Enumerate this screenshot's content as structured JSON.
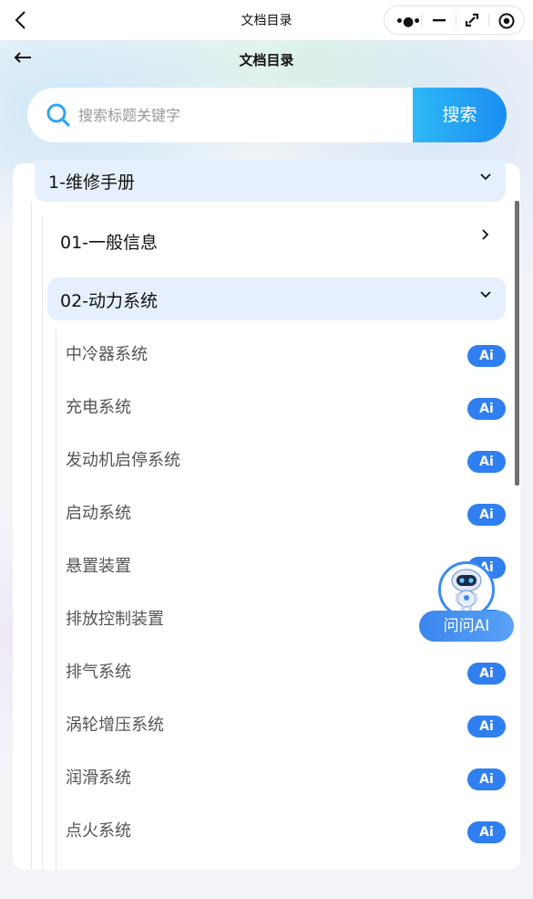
{
  "topbar": {
    "title": "文档目录"
  },
  "header": {
    "title": "文档目录"
  },
  "search": {
    "placeholder": "搜索标题关键字",
    "button_label": "搜索"
  },
  "tree": {
    "level1": {
      "label": "1-维修手册"
    },
    "level2": [
      {
        "label": "01-一般信息",
        "expanded": false
      },
      {
        "label": "02-动力系统",
        "expanded": true
      }
    ],
    "items": [
      {
        "label": "中冷器系统",
        "badge": "Ai"
      },
      {
        "label": "充电系统",
        "badge": "Ai"
      },
      {
        "label": "发动机启停系统",
        "badge": "Ai"
      },
      {
        "label": "启动系统",
        "badge": "Ai"
      },
      {
        "label": "悬置装置",
        "badge": "Ai"
      },
      {
        "label": "排放控制装置",
        "badge": "Ai"
      },
      {
        "label": "排气系统",
        "badge": "Ai"
      },
      {
        "label": "涡轮增压系统",
        "badge": "Ai"
      },
      {
        "label": "润滑系统",
        "badge": "Ai"
      },
      {
        "label": "点火系统",
        "badge": "Ai"
      }
    ]
  },
  "assistant": {
    "button_label": "问问AI",
    "avatar_icon": "robot-icon"
  },
  "colors": {
    "accent": "#2f7ff0",
    "highlight": "#e6f0fc",
    "search_button": "#1a8ef2"
  }
}
